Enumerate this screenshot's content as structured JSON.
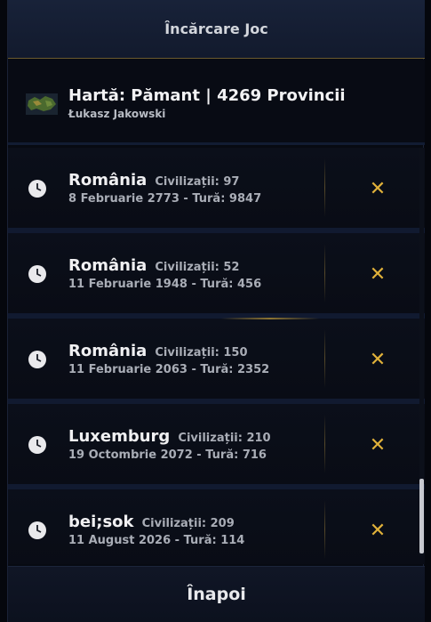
{
  "header": {
    "title": "Încărcare Joc"
  },
  "map": {
    "title": "Hartă: Pămant | 4269 Provincii",
    "author": "Łukasz Jakowski",
    "icon": "map-icon"
  },
  "saves": [
    {
      "name": "România",
      "civ": "Civilizații: 97",
      "details": "8 Februarie 2773 - Tură: 9847"
    },
    {
      "name": "România",
      "civ": "Civilizații: 52",
      "details": "11 Februarie 1948 - Tură: 456"
    },
    {
      "name": "România",
      "civ": "Civilizații: 150",
      "details": "11 Februarie 2063 - Tură: 2352"
    },
    {
      "name": "Luxemburg",
      "civ": "Civilizații: 210",
      "details": "19 Octombrie 2072 - Tură: 716"
    },
    {
      "name": "bei;sok",
      "civ": "Civilizații: 209",
      "details": "11 August 2026 - Tură: 114"
    }
  ],
  "icons": {
    "save": "clock-icon",
    "delete": "close-icon",
    "delete_glyph": "✕"
  },
  "footer": {
    "back_label": "Înapoi"
  },
  "colors": {
    "accent": "#e0b13a",
    "background": "#070a12",
    "header": "#182239"
  }
}
